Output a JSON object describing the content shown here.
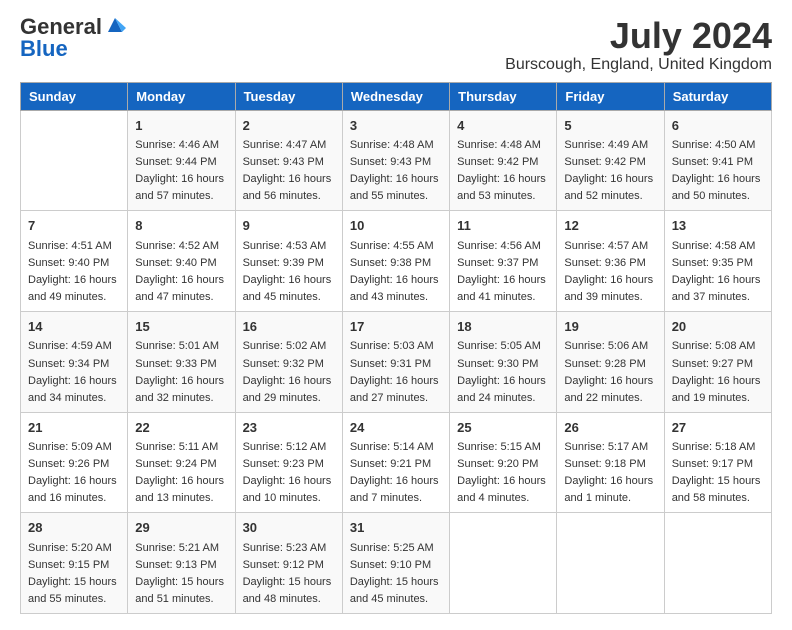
{
  "header": {
    "logo_general": "General",
    "logo_blue": "Blue",
    "month_year": "July 2024",
    "location": "Burscough, England, United Kingdom"
  },
  "days_of_week": [
    "Sunday",
    "Monday",
    "Tuesday",
    "Wednesday",
    "Thursday",
    "Friday",
    "Saturday"
  ],
  "weeks": [
    [
      {
        "day": "",
        "sunrise": "",
        "sunset": "",
        "daylight": ""
      },
      {
        "day": "1",
        "sunrise": "Sunrise: 4:46 AM",
        "sunset": "Sunset: 9:44 PM",
        "daylight": "Daylight: 16 hours and 57 minutes."
      },
      {
        "day": "2",
        "sunrise": "Sunrise: 4:47 AM",
        "sunset": "Sunset: 9:43 PM",
        "daylight": "Daylight: 16 hours and 56 minutes."
      },
      {
        "day": "3",
        "sunrise": "Sunrise: 4:48 AM",
        "sunset": "Sunset: 9:43 PM",
        "daylight": "Daylight: 16 hours and 55 minutes."
      },
      {
        "day": "4",
        "sunrise": "Sunrise: 4:48 AM",
        "sunset": "Sunset: 9:42 PM",
        "daylight": "Daylight: 16 hours and 53 minutes."
      },
      {
        "day": "5",
        "sunrise": "Sunrise: 4:49 AM",
        "sunset": "Sunset: 9:42 PM",
        "daylight": "Daylight: 16 hours and 52 minutes."
      },
      {
        "day": "6",
        "sunrise": "Sunrise: 4:50 AM",
        "sunset": "Sunset: 9:41 PM",
        "daylight": "Daylight: 16 hours and 50 minutes."
      }
    ],
    [
      {
        "day": "7",
        "sunrise": "Sunrise: 4:51 AM",
        "sunset": "Sunset: 9:40 PM",
        "daylight": "Daylight: 16 hours and 49 minutes."
      },
      {
        "day": "8",
        "sunrise": "Sunrise: 4:52 AM",
        "sunset": "Sunset: 9:40 PM",
        "daylight": "Daylight: 16 hours and 47 minutes."
      },
      {
        "day": "9",
        "sunrise": "Sunrise: 4:53 AM",
        "sunset": "Sunset: 9:39 PM",
        "daylight": "Daylight: 16 hours and 45 minutes."
      },
      {
        "day": "10",
        "sunrise": "Sunrise: 4:55 AM",
        "sunset": "Sunset: 9:38 PM",
        "daylight": "Daylight: 16 hours and 43 minutes."
      },
      {
        "day": "11",
        "sunrise": "Sunrise: 4:56 AM",
        "sunset": "Sunset: 9:37 PM",
        "daylight": "Daylight: 16 hours and 41 minutes."
      },
      {
        "day": "12",
        "sunrise": "Sunrise: 4:57 AM",
        "sunset": "Sunset: 9:36 PM",
        "daylight": "Daylight: 16 hours and 39 minutes."
      },
      {
        "day": "13",
        "sunrise": "Sunrise: 4:58 AM",
        "sunset": "Sunset: 9:35 PM",
        "daylight": "Daylight: 16 hours and 37 minutes."
      }
    ],
    [
      {
        "day": "14",
        "sunrise": "Sunrise: 4:59 AM",
        "sunset": "Sunset: 9:34 PM",
        "daylight": "Daylight: 16 hours and 34 minutes."
      },
      {
        "day": "15",
        "sunrise": "Sunrise: 5:01 AM",
        "sunset": "Sunset: 9:33 PM",
        "daylight": "Daylight: 16 hours and 32 minutes."
      },
      {
        "day": "16",
        "sunrise": "Sunrise: 5:02 AM",
        "sunset": "Sunset: 9:32 PM",
        "daylight": "Daylight: 16 hours and 29 minutes."
      },
      {
        "day": "17",
        "sunrise": "Sunrise: 5:03 AM",
        "sunset": "Sunset: 9:31 PM",
        "daylight": "Daylight: 16 hours and 27 minutes."
      },
      {
        "day": "18",
        "sunrise": "Sunrise: 5:05 AM",
        "sunset": "Sunset: 9:30 PM",
        "daylight": "Daylight: 16 hours and 24 minutes."
      },
      {
        "day": "19",
        "sunrise": "Sunrise: 5:06 AM",
        "sunset": "Sunset: 9:28 PM",
        "daylight": "Daylight: 16 hours and 22 minutes."
      },
      {
        "day": "20",
        "sunrise": "Sunrise: 5:08 AM",
        "sunset": "Sunset: 9:27 PM",
        "daylight": "Daylight: 16 hours and 19 minutes."
      }
    ],
    [
      {
        "day": "21",
        "sunrise": "Sunrise: 5:09 AM",
        "sunset": "Sunset: 9:26 PM",
        "daylight": "Daylight: 16 hours and 16 minutes."
      },
      {
        "day": "22",
        "sunrise": "Sunrise: 5:11 AM",
        "sunset": "Sunset: 9:24 PM",
        "daylight": "Daylight: 16 hours and 13 minutes."
      },
      {
        "day": "23",
        "sunrise": "Sunrise: 5:12 AM",
        "sunset": "Sunset: 9:23 PM",
        "daylight": "Daylight: 16 hours and 10 minutes."
      },
      {
        "day": "24",
        "sunrise": "Sunrise: 5:14 AM",
        "sunset": "Sunset: 9:21 PM",
        "daylight": "Daylight: 16 hours and 7 minutes."
      },
      {
        "day": "25",
        "sunrise": "Sunrise: 5:15 AM",
        "sunset": "Sunset: 9:20 PM",
        "daylight": "Daylight: 16 hours and 4 minutes."
      },
      {
        "day": "26",
        "sunrise": "Sunrise: 5:17 AM",
        "sunset": "Sunset: 9:18 PM",
        "daylight": "Daylight: 16 hours and 1 minute."
      },
      {
        "day": "27",
        "sunrise": "Sunrise: 5:18 AM",
        "sunset": "Sunset: 9:17 PM",
        "daylight": "Daylight: 15 hours and 58 minutes."
      }
    ],
    [
      {
        "day": "28",
        "sunrise": "Sunrise: 5:20 AM",
        "sunset": "Sunset: 9:15 PM",
        "daylight": "Daylight: 15 hours and 55 minutes."
      },
      {
        "day": "29",
        "sunrise": "Sunrise: 5:21 AM",
        "sunset": "Sunset: 9:13 PM",
        "daylight": "Daylight: 15 hours and 51 minutes."
      },
      {
        "day": "30",
        "sunrise": "Sunrise: 5:23 AM",
        "sunset": "Sunset: 9:12 PM",
        "daylight": "Daylight: 15 hours and 48 minutes."
      },
      {
        "day": "31",
        "sunrise": "Sunrise: 5:25 AM",
        "sunset": "Sunset: 9:10 PM",
        "daylight": "Daylight: 15 hours and 45 minutes."
      },
      {
        "day": "",
        "sunrise": "",
        "sunset": "",
        "daylight": ""
      },
      {
        "day": "",
        "sunrise": "",
        "sunset": "",
        "daylight": ""
      },
      {
        "day": "",
        "sunrise": "",
        "sunset": "",
        "daylight": ""
      }
    ]
  ]
}
